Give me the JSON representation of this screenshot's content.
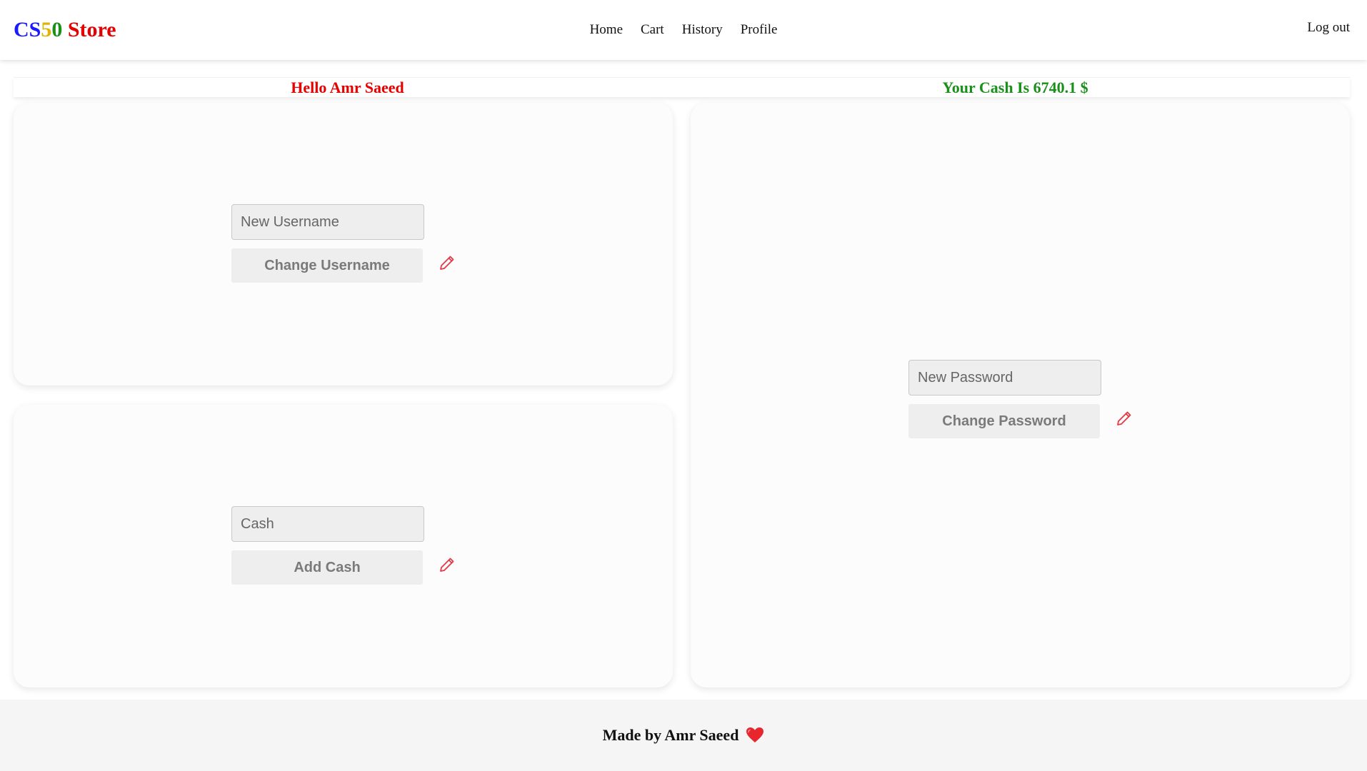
{
  "navbar": {
    "brand": [
      {
        "text": "C",
        "color": "#1a1aff"
      },
      {
        "text": "S",
        "color": "#1a1aff"
      },
      {
        "text": "5",
        "color": "#e0b500"
      },
      {
        "text": "0",
        "color": "#1a8f1a"
      },
      {
        "text": " Store",
        "color": "#e60000"
      }
    ],
    "links": [
      "Home",
      "Cart",
      "History",
      "Profile"
    ],
    "logout": "Log out"
  },
  "greeting": {
    "hello": "Hello Amr Saeed",
    "hello_color": "#e60000",
    "cash": "Your Cash Is 6740.1 $",
    "cash_color": "#1a8f1a"
  },
  "forms": {
    "username": {
      "placeholder": "New Username",
      "button": "Change Username",
      "icon": "pencil-icon"
    },
    "cash": {
      "placeholder": "Cash",
      "button": "Add Cash",
      "icon": "pencil-icon"
    },
    "password": {
      "placeholder": "New Password",
      "button": "Change Password",
      "icon": "pencil-icon"
    }
  },
  "footer": {
    "text": "Made by Amr Saeed",
    "icon": "heart-icon",
    "icon_color": "#e8262d"
  },
  "colors": {
    "accent_red": "#e60000",
    "accent_green": "#1a8f1a",
    "pencil": "#e53945"
  }
}
